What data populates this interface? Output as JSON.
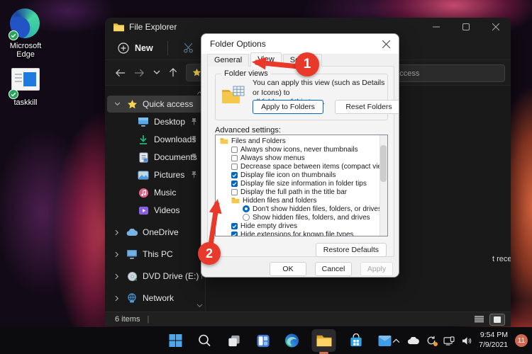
{
  "desktop": {
    "icons": [
      {
        "key": "edge",
        "label": "Microsoft Edge"
      },
      {
        "key": "taskkill",
        "label": "taskkill"
      }
    ]
  },
  "explorer": {
    "title": "File Explorer",
    "toolbar": {
      "new_label": "New"
    },
    "nav": {
      "search_placeholder": "Search Quick access"
    },
    "sidebar": {
      "items": [
        {
          "key": "quick-access",
          "label": "Quick access",
          "icon": "star",
          "chevron": "down",
          "selected": true
        },
        {
          "key": "desktop",
          "label": "Desktop",
          "icon": "desktop",
          "pinned": true,
          "indent": 1
        },
        {
          "key": "downloads",
          "label": "Downloads",
          "icon": "downloads",
          "pinned": true,
          "indent": 1
        },
        {
          "key": "documents",
          "label": "Documents",
          "icon": "documents",
          "pinned": true,
          "indent": 1
        },
        {
          "key": "pictures",
          "label": "Pictures",
          "icon": "pictures",
          "pinned": true,
          "indent": 1
        },
        {
          "key": "music",
          "label": "Music",
          "icon": "music",
          "indent": 1
        },
        {
          "key": "videos",
          "label": "Videos",
          "icon": "videos",
          "indent": 1
        },
        {
          "key": "onedrive",
          "label": "OneDrive",
          "icon": "onedrive",
          "chevron": "right",
          "gap": true
        },
        {
          "key": "this-pc",
          "label": "This PC",
          "icon": "thispc",
          "chevron": "right",
          "gap": true
        },
        {
          "key": "dvd-drive",
          "label": "DVD Drive (E:) ESD-IS",
          "icon": "dvd",
          "chevron": "right",
          "gap": true
        },
        {
          "key": "network",
          "label": "Network",
          "icon": "network",
          "chevron": "right",
          "gap": true
        }
      ]
    },
    "content": {
      "empty_hint_fragment": "t recent ones here."
    },
    "statusbar": {
      "items_count": "6 items",
      "separator": "|"
    }
  },
  "dialog": {
    "title": "Folder Options",
    "tabs": [
      {
        "label": "General",
        "active": false
      },
      {
        "label": "View",
        "active": true
      },
      {
        "label": "Search",
        "active": false
      }
    ],
    "folder_views": {
      "group_label": "Folder views",
      "description_line1": "You can apply this view (such as Details or Icons) to",
      "description_line2": "all folders of this type.",
      "apply_button": "Apply to Folders",
      "reset_button": "Reset Folders"
    },
    "advanced": {
      "label": "Advanced settings:",
      "items": [
        {
          "type": "group",
          "label": "Files and Folders",
          "indent": 0
        },
        {
          "type": "checkbox",
          "label": "Always show icons, never thumbnails",
          "checked": false,
          "indent": 1
        },
        {
          "type": "checkbox",
          "label": "Always show menus",
          "checked": false,
          "indent": 1
        },
        {
          "type": "checkbox",
          "label": "Decrease space between items (compact view)",
          "checked": false,
          "indent": 1
        },
        {
          "type": "checkbox",
          "label": "Display file icon on thumbnails",
          "checked": true,
          "indent": 1
        },
        {
          "type": "checkbox",
          "label": "Display file size information in folder tips",
          "checked": true,
          "indent": 1
        },
        {
          "type": "checkbox",
          "label": "Display the full path in the title bar",
          "checked": false,
          "indent": 1
        },
        {
          "type": "group",
          "label": "Hidden files and folders",
          "indent": 1
        },
        {
          "type": "radio",
          "label": "Don't show hidden files, folders, or drives",
          "checked": true,
          "indent": 2
        },
        {
          "type": "radio",
          "label": "Show hidden files, folders, and drives",
          "checked": false,
          "indent": 2
        },
        {
          "type": "checkbox",
          "label": "Hide empty drives",
          "checked": true,
          "indent": 1
        },
        {
          "type": "checkbox",
          "label": "Hide extensions for known file types",
          "checked": true,
          "indent": 1
        }
      ]
    },
    "buttons": {
      "restore": "Restore Defaults",
      "ok": "OK",
      "cancel": "Cancel",
      "apply": "Apply"
    }
  },
  "annotations": {
    "step1": "1",
    "step2": "2",
    "color": "#e8392b"
  },
  "taskbar": {
    "icons": [
      "start",
      "search",
      "task-view",
      "widgets",
      "edge",
      "file-explorer",
      "store",
      "mail"
    ],
    "active_icon": "file-explorer",
    "tray_icons": [
      "chevron-up",
      "onedrive-cloud",
      "sync",
      "display",
      "speaker"
    ],
    "clock": {
      "time": "9:54 PM",
      "date": "7/9/2021"
    },
    "notification_count": "11"
  },
  "colors": {
    "accent_blue": "#0067c0",
    "annotation_red": "#e8392b",
    "folder_yellow": "#f5c84c"
  }
}
